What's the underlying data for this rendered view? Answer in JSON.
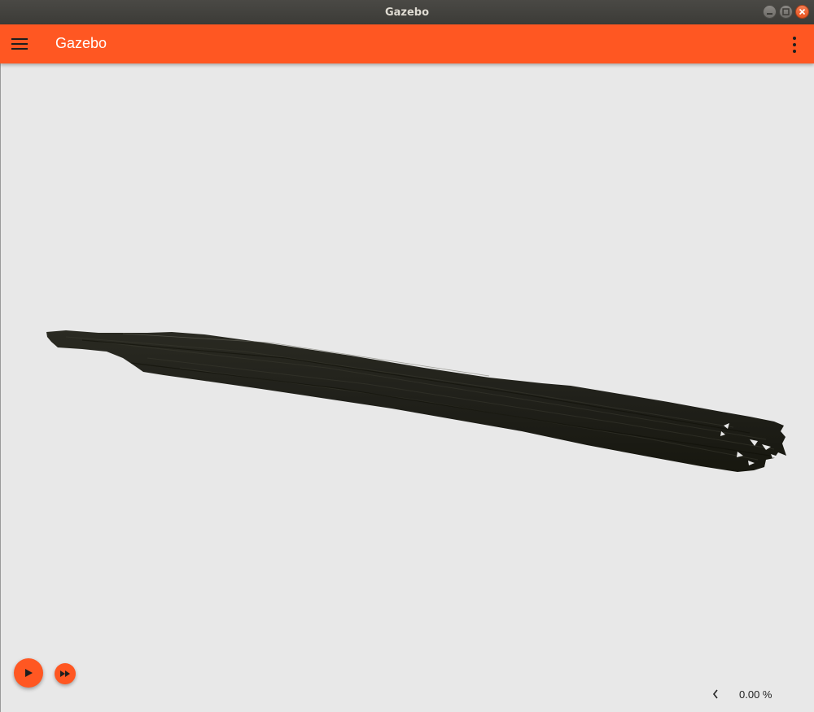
{
  "window": {
    "title": "Gazebo",
    "controls": [
      "minimize",
      "maximize",
      "close"
    ]
  },
  "appbar": {
    "title": "Gazebo",
    "menu_icon": "hamburger-menu-icon",
    "more_icon": "more-vert-icon",
    "color": "#ff5722"
  },
  "scene": {
    "background": "#e8e8e8",
    "model": "dark textured log / tree trunk mesh"
  },
  "controls": {
    "play_icon": "play-icon",
    "step_icon": "fast-forward-icon",
    "stats_toggle_icon": "chevron-left-icon",
    "real_time_factor": "0.00 %"
  }
}
